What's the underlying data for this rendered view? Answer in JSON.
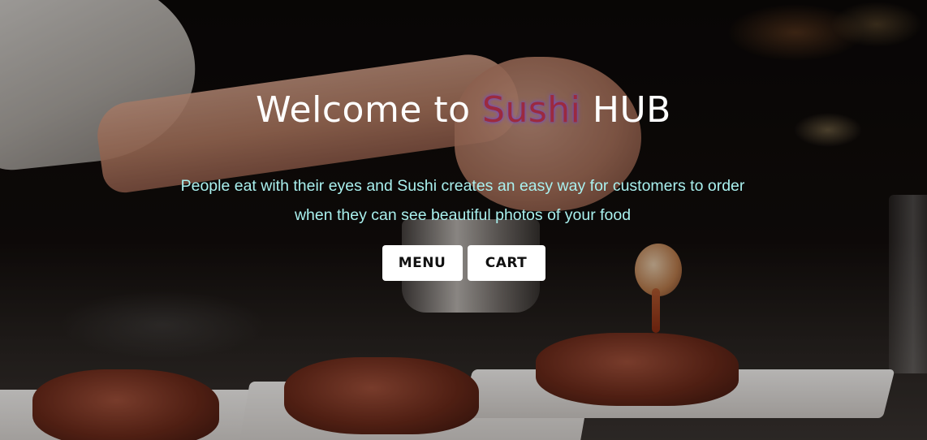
{
  "hero": {
    "title_prefix": "Welcome to ",
    "title_brand": "Sushi",
    "title_suffix": " HUB",
    "tagline": "People eat with their eyes and Sushi creates an easy way for customers to order when they can see beautiful photos of your food",
    "brand_color": "#9b2a3f",
    "tagline_color": "#a9f0ee",
    "background_image": "chef plating food with sauce spoon"
  },
  "buttons": {
    "menu_label": "MENU",
    "cart_label": "CART"
  }
}
